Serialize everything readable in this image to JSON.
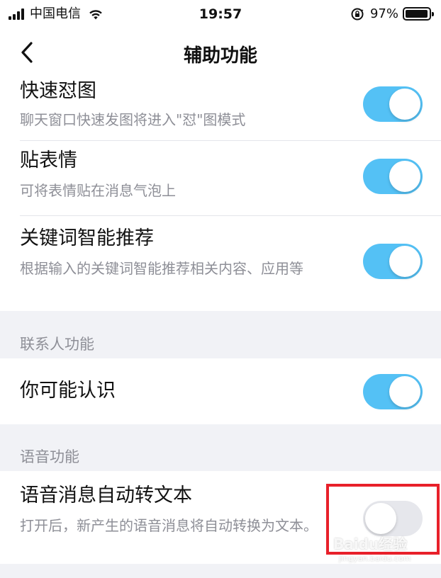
{
  "status_bar": {
    "carrier": "中国电信",
    "time": "19:57",
    "battery_percent": "97%",
    "battery_level": 0.97,
    "icons": [
      "signal-icon",
      "wifi-icon",
      "rotation-lock-icon",
      "battery-icon"
    ]
  },
  "nav": {
    "title": "辅助功能",
    "back_icon": "chevron-left-icon"
  },
  "settings": [
    {
      "title": "快速怼图",
      "desc": "聊天窗口快速发图将进入\"怼\"图模式",
      "enabled": true
    },
    {
      "title": "贴表情",
      "desc": "可将表情贴在消息气泡上",
      "enabled": true
    },
    {
      "title": "关键词智能推荐",
      "desc": "根据输入的关键词智能推荐相关内容、应用等",
      "enabled": true
    }
  ],
  "contacts_section": {
    "label": "联系人功能",
    "items": [
      {
        "title": "你可能认识",
        "enabled": true
      }
    ]
  },
  "voice_section": {
    "label": "语音功能",
    "items": [
      {
        "title": "语音消息自动转文本",
        "desc": "打开后，新产生的语音消息将自动转换为文本。",
        "enabled": false
      }
    ]
  },
  "watermark": {
    "text": "Baidu经验",
    "sub": "jingyan.baidu.com"
  },
  "colors": {
    "toggle_on": "#54c1f5",
    "toggle_off": "#e6e7ec",
    "highlight": "#e8202a",
    "background": "#f1f2f6"
  }
}
